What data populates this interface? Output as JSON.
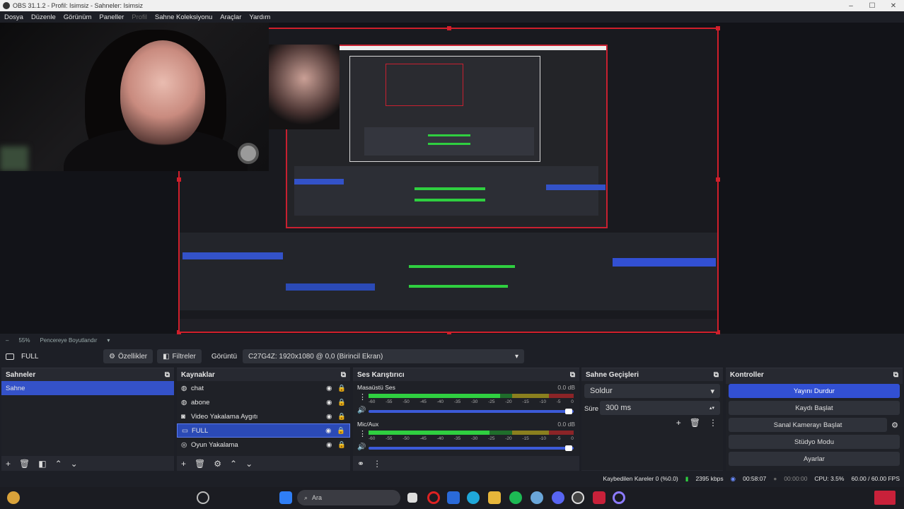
{
  "window": {
    "title": "OBS 31.1.2 - Profil: Isimsiz - Sahneler: Isimsiz"
  },
  "menu": [
    "Dosya",
    "Düzenle",
    "Görünüm",
    "Paneller",
    "Profil",
    "Sahne Koleksiyonu",
    "Araçlar",
    "Yardım"
  ],
  "zoom": {
    "percent": "55%",
    "mode": "Pencereye Boyutlandır"
  },
  "source_toolbar": {
    "selected_source": "FULL",
    "properties_label": "Özellikler",
    "filters_label": "Filtreler",
    "display_label": "Görüntü",
    "display_value": "C27G4Z: 1920x1080 @ 0,0 (Birincil Ekran)"
  },
  "scenes": {
    "title": "Sahneler",
    "items": [
      "Sahne"
    ]
  },
  "sources": {
    "title": "Kaynaklar",
    "items": [
      {
        "label": "chat",
        "icon": "browser-icon"
      },
      {
        "label": "abone",
        "icon": "browser-icon"
      },
      {
        "label": "Video Yakalama Aygıtı",
        "icon": "camera-icon"
      },
      {
        "label": "FULL",
        "icon": "monitor-icon"
      },
      {
        "label": "Oyun Yakalama",
        "icon": "gamepad-icon"
      }
    ]
  },
  "mixer": {
    "title": "Ses Karıştırıcı",
    "ticks": [
      "-60",
      "-55",
      "-50",
      "-45",
      "-40",
      "-35",
      "-30",
      "-25",
      "-20",
      "-15",
      "-10",
      "-5",
      "0"
    ],
    "channels": [
      {
        "name": "Masaüstü Ses",
        "db": "0.0 dB",
        "level": 0.64,
        "volume": 1.0
      },
      {
        "name": "Mic/Aux",
        "db": "0.0 dB",
        "level": 0.59,
        "volume": 1.0
      }
    ]
  },
  "transitions": {
    "title": "Sahne Geçişleri",
    "selected": "Soldur",
    "duration_label": "Süre",
    "duration_value": "300 ms"
  },
  "controls": {
    "title": "Kontroller",
    "buttons": [
      "Yayını Durdur",
      "Kaydı Başlat",
      "Sanal Kamerayı Başlat",
      "Stüdyo Modu",
      "Ayarlar"
    ]
  },
  "status": {
    "dropped": "Kaybedilen Kareler 0 (%0.0)",
    "bitrate": "2395 kbps",
    "stream_time": "00:58:07",
    "rec_time": "00:00:00",
    "cpu": "CPU: 3.5%",
    "fps": "60.00 / 60.00 FPS"
  },
  "taskbar": {
    "search_placeholder": "Ara"
  }
}
